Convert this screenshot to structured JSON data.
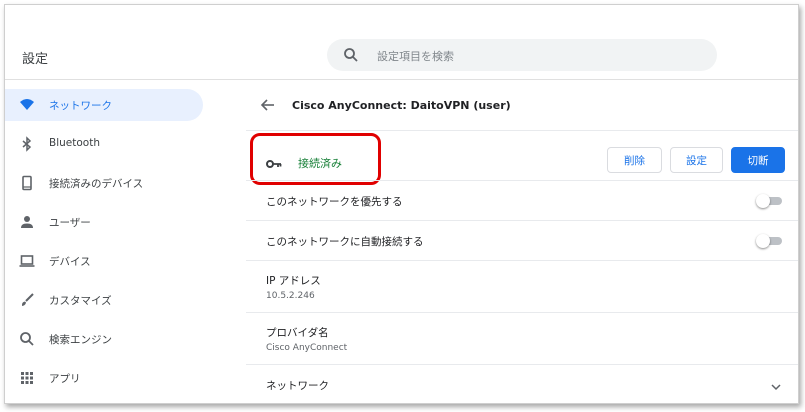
{
  "header": {
    "title": "設定",
    "search_placeholder": "設定項目を検索"
  },
  "sidebar": {
    "items": [
      {
        "label": "ネットワーク",
        "icon": "wifi-icon",
        "active": true
      },
      {
        "label": "Bluetooth",
        "icon": "bluetooth-icon"
      },
      {
        "label": "接続済みのデバイス",
        "icon": "phone-icon"
      },
      {
        "label": "ユーザー",
        "icon": "person-icon"
      },
      {
        "label": "デバイス",
        "icon": "laptop-icon"
      },
      {
        "label": "カスタマイズ",
        "icon": "brush-icon"
      },
      {
        "label": "検索エンジン",
        "icon": "search-icon"
      },
      {
        "label": "アプリ",
        "icon": "apps-grid-icon"
      }
    ]
  },
  "main": {
    "title": "Cisco AnyConnect: DaitoVPN (user)",
    "status": "接続済み",
    "buttons": {
      "delete": "削除",
      "settings": "設定",
      "disconnect": "切断"
    },
    "prefer_network_label": "このネットワークを優先する",
    "auto_connect_label": "このネットワークに自動接続する",
    "ip_label": "IP アドレス",
    "ip_value": "10.5.2.246",
    "provider_label": "プロバイダ名",
    "provider_value": "Cisco AnyConnect",
    "network_label": "ネットワーク"
  },
  "colors": {
    "accent": "#1a73e8",
    "connected": "#188038",
    "highlight": "#e00000"
  }
}
